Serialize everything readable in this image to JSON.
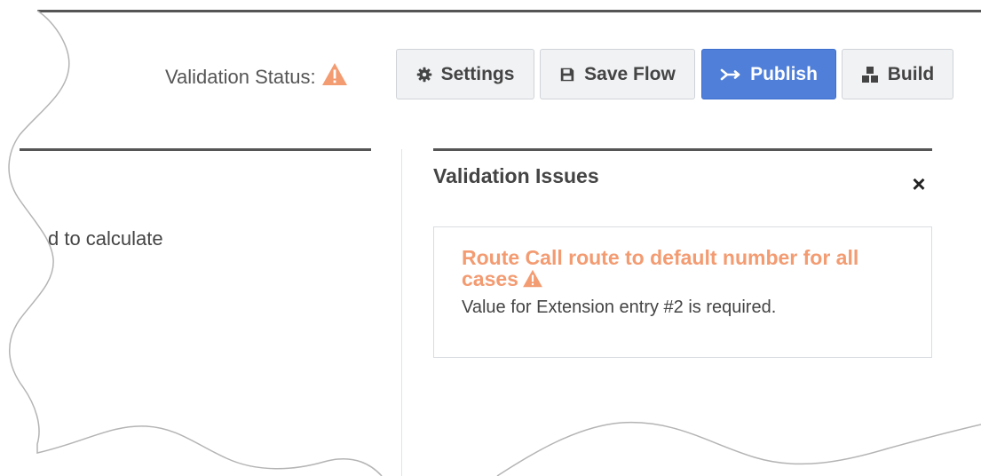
{
  "header": {
    "validation_status_label": "Validation Status:",
    "status_icon": "warning-triangle-icon",
    "status_color": "#f39b71"
  },
  "toolbar": {
    "settings_label": "Settings",
    "save_label": "Save Flow",
    "publish_label": "Publish",
    "build_label": "Build",
    "icons": {
      "settings": "gear-icon",
      "save": "floppy-disk-icon",
      "publish": "publish-arrow-icon",
      "build": "build-blocks-icon"
    },
    "publish_color": "#4f7fd9"
  },
  "left_pane": {
    "text": "d to calculate"
  },
  "validation_panel": {
    "title": "Validation Issues",
    "close_label": "×",
    "issues": [
      {
        "title": "Route Call route to default number for all cases",
        "detail": "Value for Extension entry #2 is required.",
        "severity_color": "#f39b71"
      }
    ]
  }
}
